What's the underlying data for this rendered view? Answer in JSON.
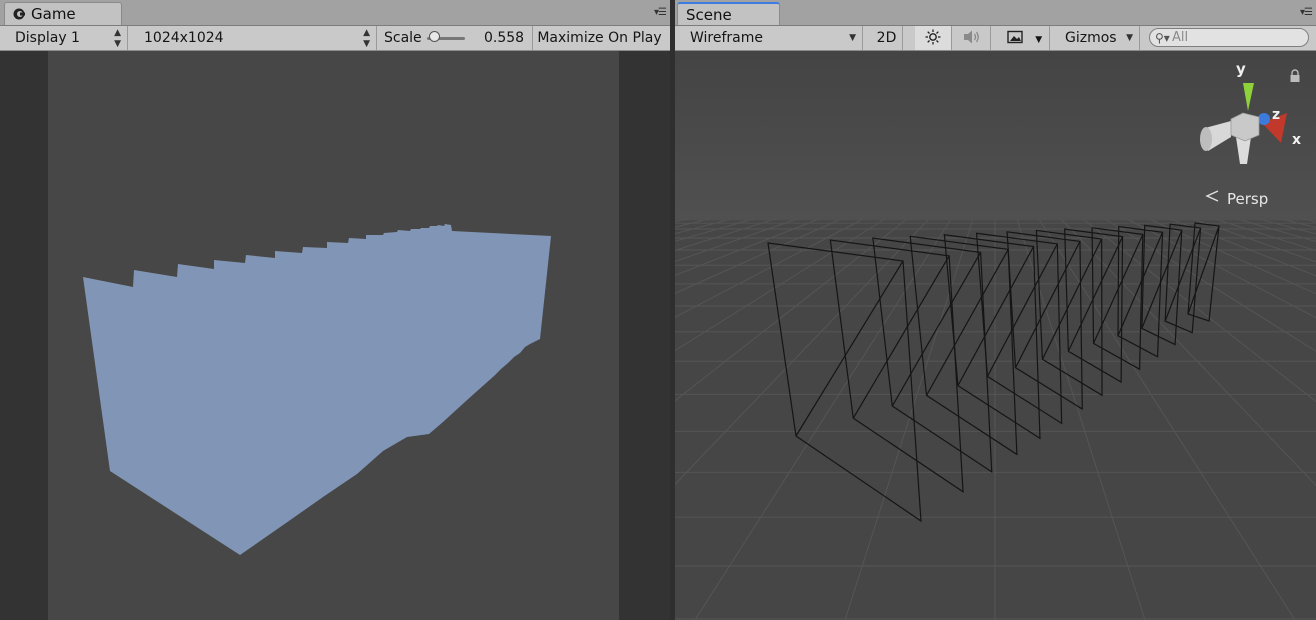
{
  "game": {
    "tab_label": "Game",
    "display_select": "Display 1",
    "resolution_select": "1024x1024",
    "scale_label": "Scale",
    "scale_value": "0.558",
    "maximize_button": "Maximize On Play"
  },
  "scene": {
    "tab_label": "Scene",
    "draw_mode_select": "Wireframe",
    "mode_2d_button": "2D",
    "gizmos_button": "Gizmos",
    "search_placeholder": "All",
    "persp_label": "Persp",
    "axis_labels": {
      "x": "x",
      "y": "y",
      "z": "z"
    }
  },
  "colors": {
    "quad_fill": "#8196b6",
    "tab_active_accent": "#3d7be0",
    "gizmo_x": "#c0392b",
    "gizmo_y": "#8ed13b",
    "gizmo_z": "#3b7bdd"
  },
  "icons": [
    "unity-game-icon",
    "panel-menu-icon",
    "lighting-icon",
    "audio-icon",
    "effects-icon",
    "search-icon",
    "lock-icon"
  ]
}
